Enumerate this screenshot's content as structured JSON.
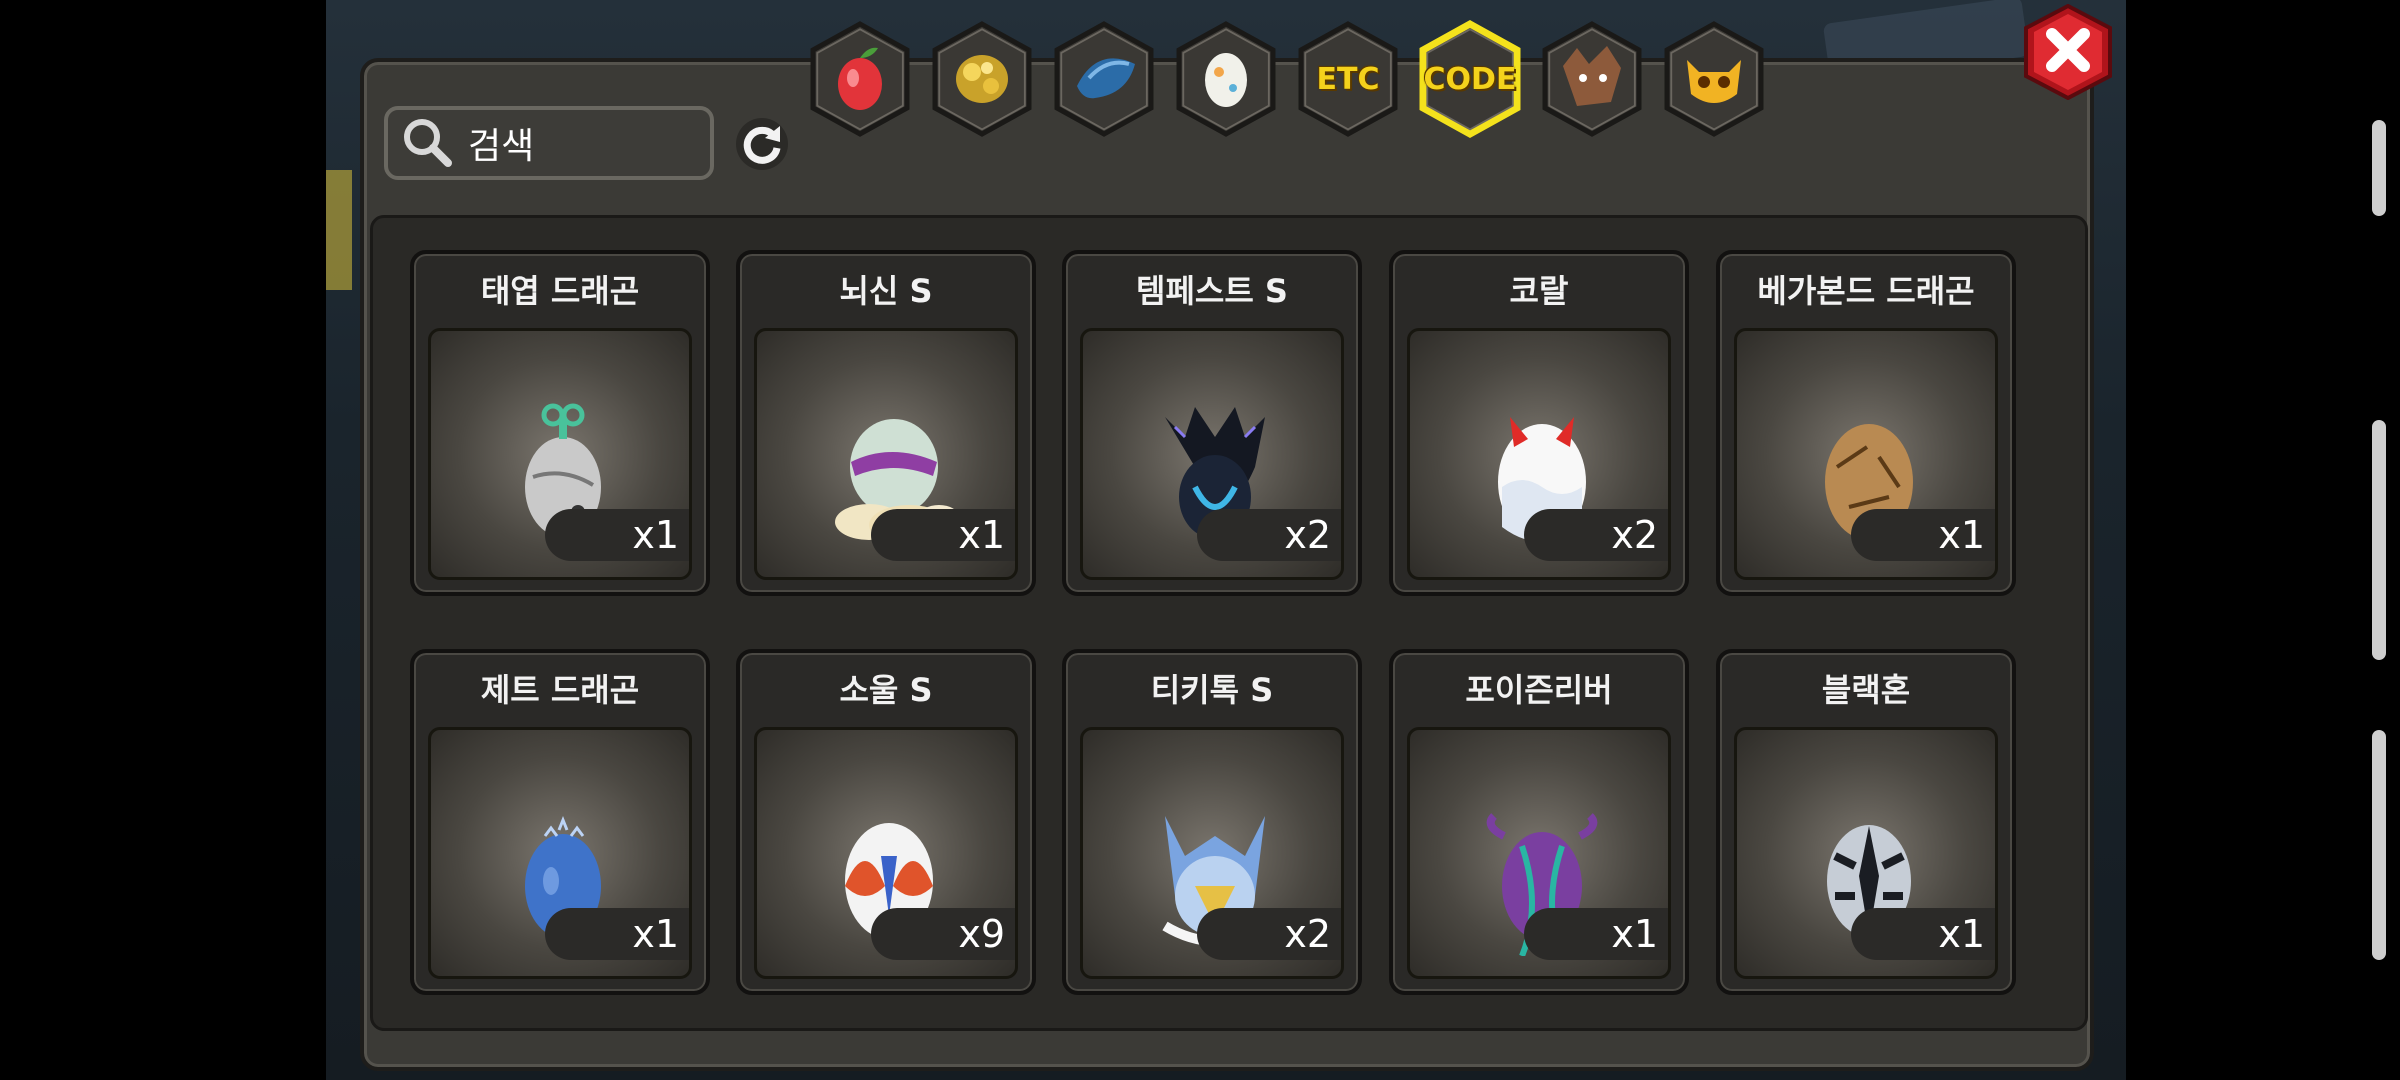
{
  "search": {
    "placeholder": "검색"
  },
  "tabs": [
    {
      "name": "fruit",
      "icon": "fruit-icon",
      "label": ""
    },
    {
      "name": "gold",
      "icon": "gold-nugget-icon",
      "label": ""
    },
    {
      "name": "dragon-item",
      "icon": "dragon-scale-icon",
      "label": ""
    },
    {
      "name": "egg",
      "icon": "egg-icon",
      "label": ""
    },
    {
      "name": "etc",
      "icon": "",
      "label": "ETC"
    },
    {
      "name": "code",
      "icon": "",
      "label": "CODE",
      "selected": true
    },
    {
      "name": "beast",
      "icon": "beast-head-icon",
      "label": ""
    },
    {
      "name": "mask",
      "icon": "mask-icon",
      "label": ""
    }
  ],
  "items": [
    {
      "name": "태엽 드래곤",
      "qty": "x1",
      "icon": "wind-up-egg-icon"
    },
    {
      "name": "뇌신 S",
      "qty": "x1",
      "icon": "cloud-egg-icon"
    },
    {
      "name": "템페스트 S",
      "qty": "x2",
      "icon": "tempest-egg-icon"
    },
    {
      "name": "코랄",
      "qty": "x2",
      "icon": "coral-egg-icon"
    },
    {
      "name": "베가본드 드래곤",
      "qty": "x1",
      "icon": "vagabond-egg-icon"
    },
    {
      "name": "제트 드래곤",
      "qty": "x1",
      "icon": "jet-egg-icon"
    },
    {
      "name": "소울 S",
      "qty": "x9",
      "icon": "soul-egg-icon"
    },
    {
      "name": "티키톡 S",
      "qty": "x2",
      "icon": "tikitok-egg-icon"
    },
    {
      "name": "포이즌리버",
      "qty": "x1",
      "icon": "poison-river-egg-icon"
    },
    {
      "name": "블랙혼",
      "qty": "x1",
      "icon": "blackhorn-egg-icon"
    }
  ],
  "colors": {
    "highlight": "#f4d21c",
    "close": "#d8222a"
  }
}
